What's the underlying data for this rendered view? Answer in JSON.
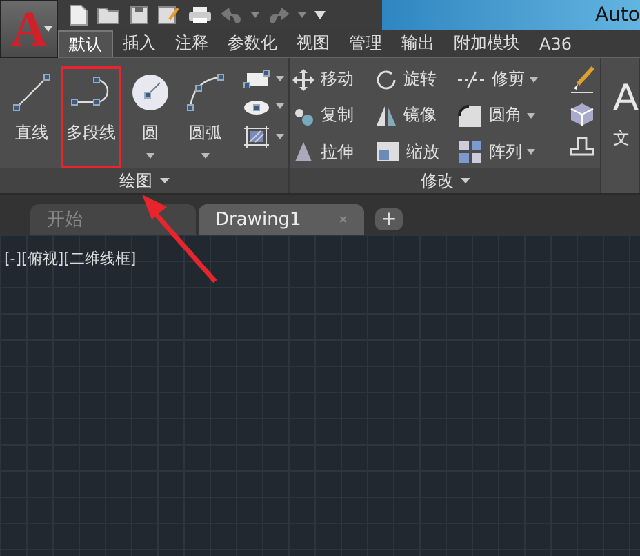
{
  "app_button": {
    "logo": "A"
  },
  "window": {
    "title": "Auto"
  },
  "ribbon_tabs": [
    {
      "label": "默认",
      "selected": true
    },
    {
      "label": "插入",
      "selected": false
    },
    {
      "label": "注释",
      "selected": false
    },
    {
      "label": "参数化",
      "selected": false
    },
    {
      "label": "视图",
      "selected": false
    },
    {
      "label": "管理",
      "selected": false
    },
    {
      "label": "输出",
      "selected": false
    },
    {
      "label": "附加模块",
      "selected": false
    },
    {
      "label": "A36",
      "selected": false
    }
  ],
  "draw_panel": {
    "title": "绘图",
    "tools": [
      {
        "label": "直线",
        "kind": "line",
        "dropdown": false,
        "highlighted": false
      },
      {
        "label": "多段线",
        "kind": "polyline",
        "dropdown": false,
        "highlighted": true
      },
      {
        "label": "圆",
        "kind": "circle",
        "dropdown": true,
        "highlighted": false
      },
      {
        "label": "圆弧",
        "kind": "arc",
        "dropdown": true,
        "highlighted": false
      }
    ]
  },
  "modify_panel": {
    "title": "修改",
    "tools": [
      {
        "label": "移动",
        "kind": "move",
        "dropdown": false
      },
      {
        "label": "旋转",
        "kind": "rotate",
        "dropdown": false
      },
      {
        "label": "修剪",
        "kind": "trim",
        "dropdown": true
      },
      {
        "label": "复制",
        "kind": "copy",
        "dropdown": false
      },
      {
        "label": "镜像",
        "kind": "mirror",
        "dropdown": false
      },
      {
        "label": "圆角",
        "kind": "fillet",
        "dropdown": true
      },
      {
        "label": "拉伸",
        "kind": "stretch",
        "dropdown": false
      },
      {
        "label": "缩放",
        "kind": "scale",
        "dropdown": false
      },
      {
        "label": "阵列",
        "kind": "array",
        "dropdown": true
      }
    ]
  },
  "annotation_panel": {
    "text_icon": "A",
    "label": "文"
  },
  "file_tabs": [
    {
      "label": "开始",
      "selected": false,
      "closable": false
    },
    {
      "label": "Drawing1",
      "selected": true,
      "closable": true
    }
  ],
  "new_tab_button": "+",
  "viewport": {
    "label": "[-][俯视][二维线框]"
  },
  "annotations": [
    {
      "kind": "arrow"
    }
  ]
}
